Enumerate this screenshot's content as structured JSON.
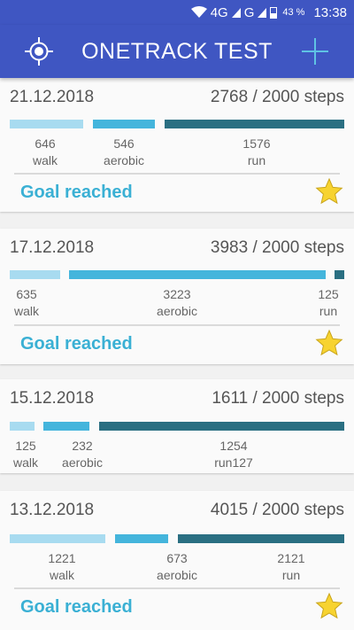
{
  "status_bar": {
    "network": "4G",
    "network2": "G",
    "battery": "43 %",
    "time": "13:38"
  },
  "app_bar": {
    "title": "ONETRACK TEST",
    "left_icon": "crosshair-icon",
    "right_icon": "plus-icon"
  },
  "colors": {
    "app_bar": "#3f56c2",
    "walk": "#a8dbf0",
    "aerobic": "#44b5dc",
    "run": "#2a6f82",
    "goal_text": "#3ab0d4",
    "star": "#f7d330"
  },
  "cards": [
    {
      "date": "21.12.2018",
      "steps": "2768 / 2000  steps",
      "walk": {
        "count": "646",
        "label": "walk"
      },
      "aerobic": {
        "count": "546",
        "label": "aerobic"
      },
      "run": {
        "count": "1576",
        "label": "run"
      },
      "goal": "Goal reached"
    },
    {
      "date": "17.12.2018",
      "steps": "3983 / 2000  steps",
      "walk": {
        "count": "635",
        "label": "walk"
      },
      "aerobic": {
        "count": "3223",
        "label": "aerobic"
      },
      "run": {
        "count": "125",
        "label": "run"
      },
      "goal": "Goal reached"
    },
    {
      "date": "15.12.2018",
      "steps": "1611 / 2000  steps",
      "walk": {
        "count": "125",
        "label": "walk"
      },
      "aerobic": {
        "count": "232",
        "label": "aerobic"
      },
      "run": {
        "count": "1254",
        "label": "run127"
      },
      "goal": ""
    },
    {
      "date": "13.12.2018",
      "steps": "4015 / 2000  steps",
      "walk": {
        "count": "1221",
        "label": "walk"
      },
      "aerobic": {
        "count": "673",
        "label": "aerobic"
      },
      "run": {
        "count": "2121",
        "label": "run"
      },
      "goal": "Goal reached"
    }
  ]
}
